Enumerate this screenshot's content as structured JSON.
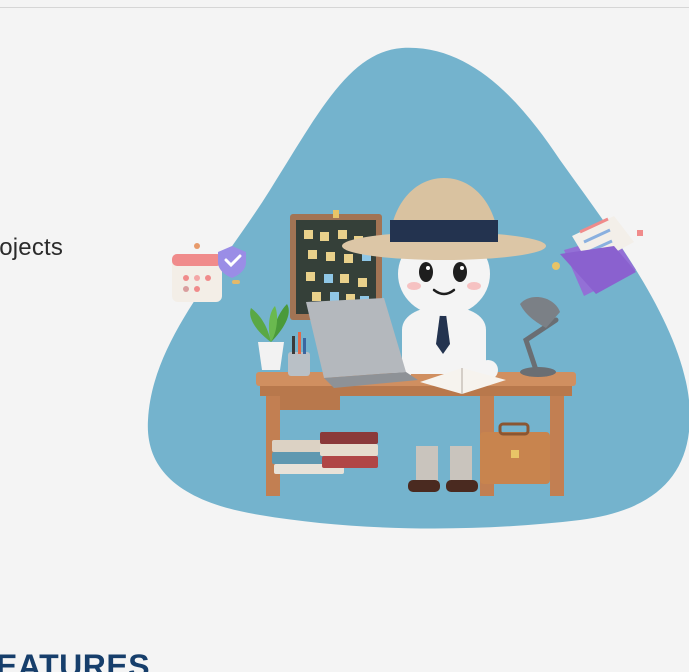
{
  "hero": {
    "text": "rojects"
  },
  "features": {
    "heading": "EATURES"
  },
  "colors": {
    "background": "#f4f4f4",
    "blob": "#74b3cd",
    "heading": "#163e6b",
    "text": "#2b2b2b"
  },
  "illustration": {
    "subject": "detective-character-at-desk-icon"
  }
}
